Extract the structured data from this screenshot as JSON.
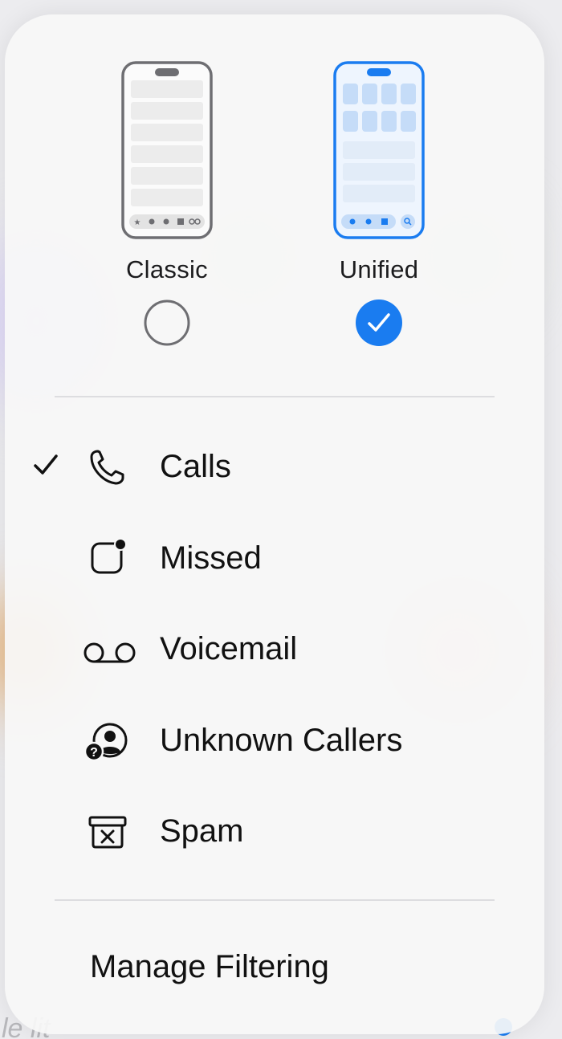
{
  "layouts": [
    {
      "label": "Classic",
      "selected": false
    },
    {
      "label": "Unified",
      "selected": true
    }
  ],
  "filters": [
    {
      "label": "Calls",
      "icon": "phone-icon",
      "checked": true
    },
    {
      "label": "Missed",
      "icon": "missed-badge-icon",
      "checked": false
    },
    {
      "label": "Voicemail",
      "icon": "voicemail-icon",
      "checked": false
    },
    {
      "label": "Unknown Callers",
      "icon": "unknown-caller-icon",
      "checked": false
    },
    {
      "label": "Spam",
      "icon": "spam-box-icon",
      "checked": false
    }
  ],
  "manage_filtering_label": "Manage Filtering",
  "colors": {
    "accent": "#1a7cf0",
    "text": "#111111",
    "classic_frame": "#6e6e72"
  }
}
